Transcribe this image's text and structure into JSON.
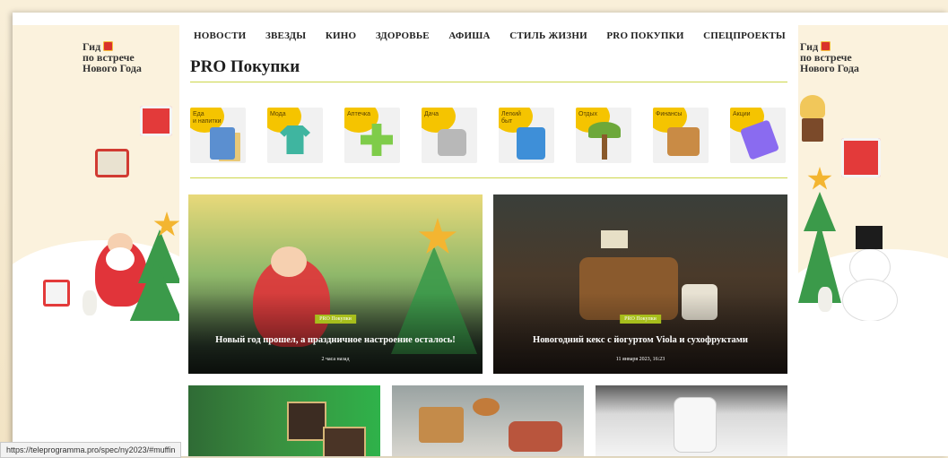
{
  "nav": [
    "НОВОСТИ",
    "ЗВЕЗДЫ",
    "КИНО",
    "ЗДОРОВЬЕ",
    "АФИША",
    "СТИЛЬ ЖИЗНИ",
    "PRO ПОКУПКИ",
    "СПЕЦПРОЕКТЫ"
  ],
  "side_banner": {
    "left": {
      "line1": "Гид",
      "line2": "по встрече",
      "line3": "Нового Года"
    },
    "right": {
      "line1": "Гид",
      "line2": "по встрече",
      "line3": "Нового Года"
    }
  },
  "page_title": "PRO Покупки",
  "categories": [
    {
      "label": "Еда\nи напитки",
      "icon": "food-icon",
      "color": "#5b8fd0"
    },
    {
      "label": "Мода",
      "icon": "tshirt-icon",
      "color": "#3fb5a0"
    },
    {
      "label": "Аптечка",
      "icon": "cross-icon",
      "color": "#7fcc4a"
    },
    {
      "label": "Дача",
      "icon": "watering-can-icon",
      "color": "#b8b8b8"
    },
    {
      "label": "Легкий\nбыт",
      "icon": "washing-machine-icon",
      "color": "#3e8fd8"
    },
    {
      "label": "Отдых",
      "icon": "palm-icon",
      "color": "#6da83a"
    },
    {
      "label": "Финансы",
      "icon": "wallet-icon",
      "color": "#c98b45"
    },
    {
      "label": "Акции",
      "icon": "ticket-icon",
      "color": "#8a6bf0"
    }
  ],
  "featured": [
    {
      "badge": "PRO Покупки",
      "title": "Новый год прошел, а праздничное настроение осталось!",
      "meta": "2 часа назад"
    },
    {
      "badge": "PRO Покупки",
      "title": "Новогодний кекс с йогуртом Viola и сухофруктами",
      "meta": "11 января 2023, 16:23"
    }
  ],
  "status_url": "https://teleprogramma.pro/spec/ny2023/#muffin",
  "colors": {
    "accent": "#a7be1c",
    "rule": "#cdd64a",
    "category_blob": "#f5c400"
  }
}
